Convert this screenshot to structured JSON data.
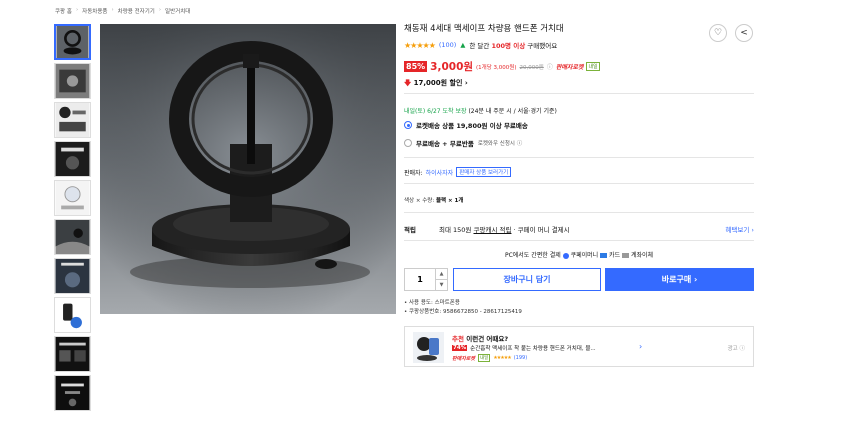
{
  "breadcrumb": [
    "쿠팡 홈",
    "자동차용품",
    "차량용 전자기기",
    "일반거치대"
  ],
  "product": {
    "title": "채동재 4세대 맥세이프 차량용 핸드폰 거치대",
    "stars": "★★★★★",
    "review_count": "(100)",
    "bought_prefix": "한 달간",
    "bought_count": "100명 이상",
    "bought_suffix": "구매했어요",
    "discount_pct": "85%",
    "price": "3,000원",
    "unit_price": "(1개당 3,000원)",
    "original_price": "20,000원",
    "rocket_label": "판매자로켓",
    "tomorrow_tag": "내일",
    "coupon_text": "17,000원 할인"
  },
  "delivery": {
    "date_label": "내일(토) 6/27 도착 보장",
    "date_note": "(24분 내 주문 시 / 서울⋅경기 기준)",
    "opt1_label": "로켓배송 상품 19,800원 이상 무료배송",
    "opt2_label": "무료배송 + 무료반품",
    "opt2_sub": "로켓와우 신청시 ⓘ"
  },
  "seller": {
    "label": "판매자:",
    "name": "하이사자자",
    "button": "판매자 상품 보러가기"
  },
  "option": {
    "label": "색상 × 수량:",
    "value": "블랙 × 1개"
  },
  "points": {
    "label": "적립",
    "text1": "최대 150원",
    "text2": "쿠팡캐시 적립",
    "text3": "· 쿠페이 머니 결제시",
    "more": "혜택보기 ›"
  },
  "easy_pay": {
    "label": "PC에서도 간편한 결제",
    "m1": "쿠페이머니",
    "m2": "카드",
    "m3": "계좌이체"
  },
  "purchase": {
    "qty": "1",
    "cart": "장바구니 담기",
    "buy": "바로구매 ›"
  },
  "bullets": [
    "사용 용도: 스마트폰용",
    "쿠팡상품번호: 9586672850 - 28617125419"
  ],
  "recommend": {
    "head_red": "추천",
    "head_rest": "이런건 어때요?",
    "pct": "74%",
    "name": "순간흡착 맥세이프 착 붙는 차량용 핸드폰 거치대, 블...",
    "rocket": "판매자로켓",
    "tomorrow": "내일",
    "stars": "★★★★★",
    "count": "(199)",
    "ad": "광고 ⓘ"
  },
  "colors": {
    "accent": "#346aff",
    "red": "#e52528",
    "star": "#f59e0b"
  }
}
